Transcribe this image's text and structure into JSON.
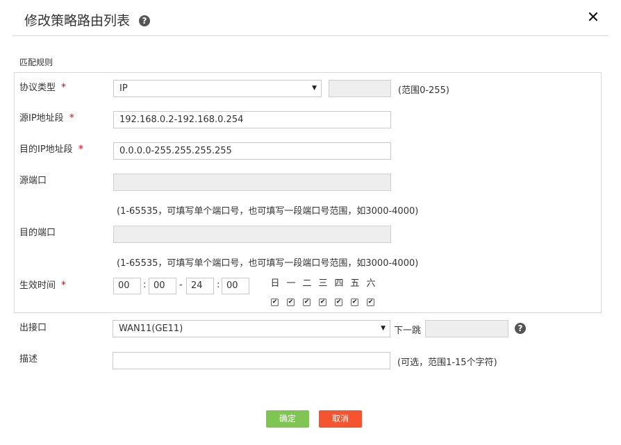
{
  "dialog": {
    "title": "修改策略路由列表",
    "help_glyph": "?",
    "close_glyph": "✕"
  },
  "match_rules": {
    "section_title": "匹配规则",
    "protocol": {
      "label": "协议类型",
      "required_mark": "*",
      "selected": "IP",
      "number_value": "",
      "range_hint": "(范围0-255)"
    },
    "src_ip": {
      "label": "源IP地址段",
      "required_mark": "*",
      "value": "192.168.0.2-192.168.0.254"
    },
    "dst_ip": {
      "label": "目的IP地址段",
      "required_mark": "*",
      "value": "0.0.0.0-255.255.255.255"
    },
    "src_port": {
      "label": "源端口",
      "value": "",
      "hint": "(1-65535，可填写单个端口号，也可填写一段端口号范围，如3000-4000)"
    },
    "dst_port": {
      "label": "目的端口",
      "value": "",
      "hint": "(1-65535，可填写单个端口号，也可填写一段端口号范围，如3000-4000)"
    },
    "schedule": {
      "label": "生效时间",
      "required_mark": "*",
      "start_hour": "00",
      "start_minute": "00",
      "end_hour": "24",
      "end_minute": "00",
      "colon": ":",
      "dash": "-",
      "days": [
        "日",
        "一",
        "二",
        "三",
        "四",
        "五",
        "六"
      ],
      "checked_glyph": "✔"
    }
  },
  "egress": {
    "label": "出接口",
    "selected": "WAN11(GE11)",
    "next_hop_label": "下一跳",
    "next_hop_value": ""
  },
  "description": {
    "label": "描述",
    "value": "",
    "hint": "(可选，范围1-15个字符)"
  },
  "buttons": {
    "ok": "确定",
    "cancel": "取消"
  },
  "icons": {
    "dropdown": "▼"
  }
}
